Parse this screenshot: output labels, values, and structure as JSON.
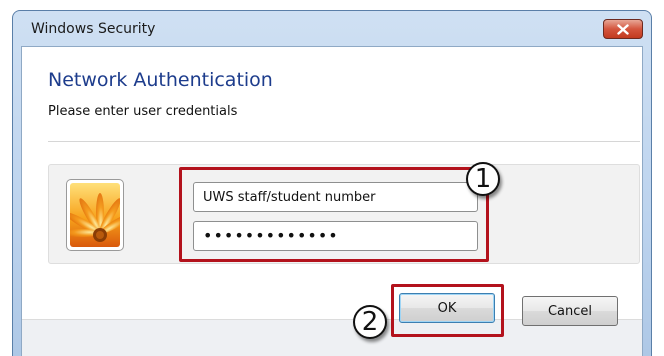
{
  "window": {
    "title": "Windows Security",
    "close_label": "Close"
  },
  "dialog": {
    "heading": "Network Authentication",
    "subheading": "Please enter user credentials"
  },
  "credentials": {
    "username_value": "UWS staff/student number",
    "password_masked": "•••••••••••••",
    "avatar_icon": "user-tile-flower-icon"
  },
  "buttons": {
    "ok_label": "OK",
    "cancel_label": "Cancel"
  },
  "annotations": {
    "callout_1": "1",
    "callout_2": "2",
    "highlight_color": "#b3121c"
  },
  "colors": {
    "heading": "#1d3c8c",
    "close_button": "#c23a20"
  }
}
